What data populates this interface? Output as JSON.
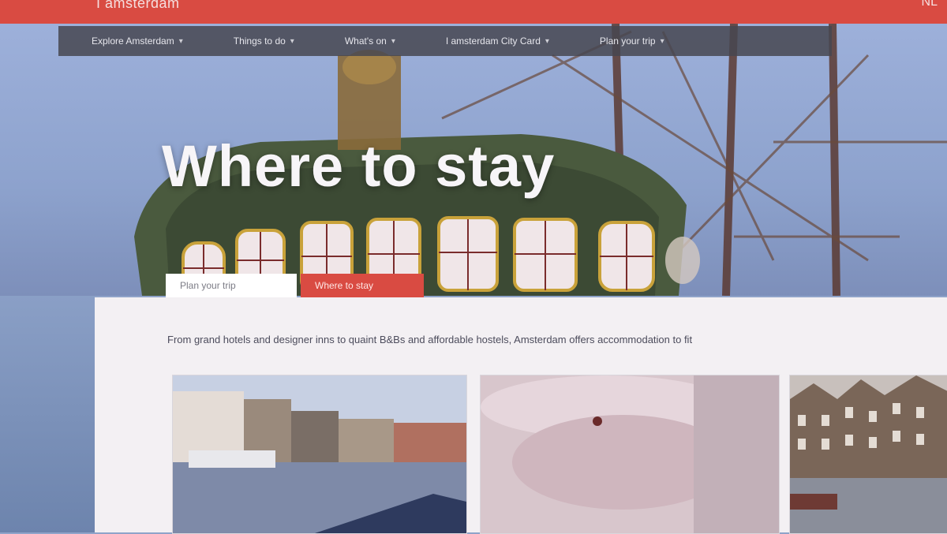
{
  "header": {
    "brand": "I amsterdam",
    "right_label": "NL"
  },
  "nav": {
    "items": [
      {
        "label": "Explore Amsterdam"
      },
      {
        "label": "Things to do"
      },
      {
        "label": "What's on"
      },
      {
        "label": "I amsterdam City Card"
      },
      {
        "label": "Plan your trip"
      }
    ],
    "chevron_icon": "chevron-down-icon"
  },
  "hero": {
    "title": "Where to stay"
  },
  "tabs": {
    "plan_label": "Plan your trip",
    "where_label": "Where to stay"
  },
  "content": {
    "intro": "From grand hotels and designer inns to quaint B&Bs and affordable hostels, Amsterdam offers accommodation to fit"
  },
  "colors": {
    "accent": "#d94b42",
    "nav_bg": "#46464f",
    "panel_bg": "#f3f0f3"
  }
}
